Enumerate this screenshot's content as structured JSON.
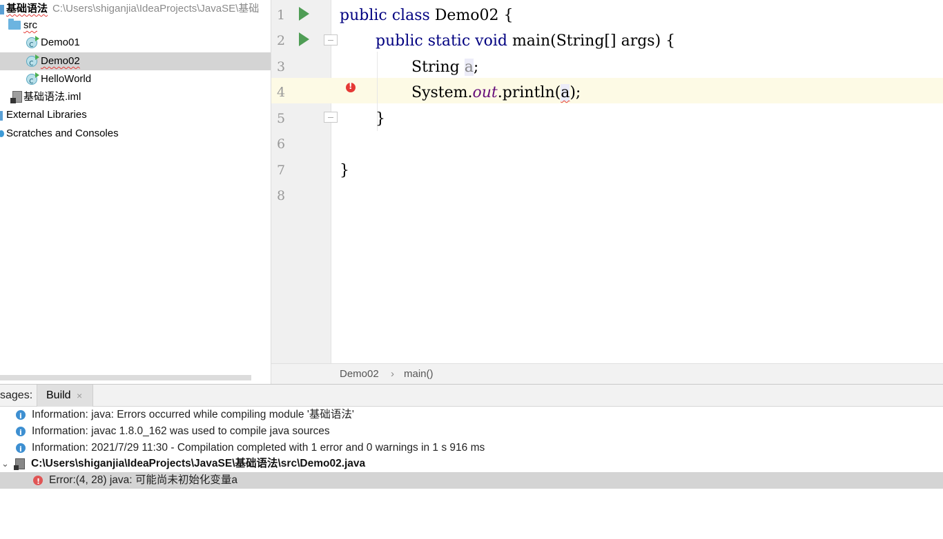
{
  "project_tree": {
    "module_name": "基础语法",
    "module_path": "C:\\Users\\shiganjia\\IdeaProjects\\JavaSE\\基础",
    "folder": "src",
    "classes": [
      "Demo01",
      "Demo02",
      "HelloWorld"
    ],
    "iml_file": "基础语法.iml",
    "external_libraries": "External Libraries",
    "scratches": "Scratches and Consoles"
  },
  "editor": {
    "line_numbers": [
      "1",
      "2",
      "3",
      "4",
      "5",
      "6",
      "7",
      "8"
    ],
    "code": {
      "l1_kw": "public class",
      "l1_rest": " Demo02 {",
      "l2_kw": "public static void",
      "l2_rest": " main(String[] args) {",
      "l3_type": "String ",
      "l3_var": "a",
      "l3_end": ";",
      "l4_a": "System.",
      "l4_field": "out",
      "l4_b": ".println(",
      "l4_var": "a",
      "l4_c": ");",
      "l5": "}",
      "l7": "}"
    },
    "breadcrumb": [
      "Demo02",
      "main()"
    ],
    "breadcrumb_sep": "›"
  },
  "messages": {
    "panel_title": "sages:",
    "tab_label": "Build",
    "tab_close": "×",
    "info_lines": [
      "Information: java: Errors occurred while compiling module '基础语法'",
      "Information: javac 1.8.0_162 was used to compile java sources",
      "Information: 2021/7/29 11:30 - Compilation completed with 1 error and 0 warnings in 1 s 916 ms"
    ],
    "file_path": "C:\\Users\\shiganjia\\IdeaProjects\\JavaSE\\基础语法\\src\\Demo02.java",
    "error_line": "Error:(4, 28)  java: 可能尚未初始化变量a",
    "chevron": "⌄"
  },
  "colors": {
    "keyword": "#000080",
    "field": "#660e7a",
    "error": "#e53935",
    "run": "#4f9d55",
    "selection": "#d4d4d4",
    "current_line": "#fdfae5"
  }
}
